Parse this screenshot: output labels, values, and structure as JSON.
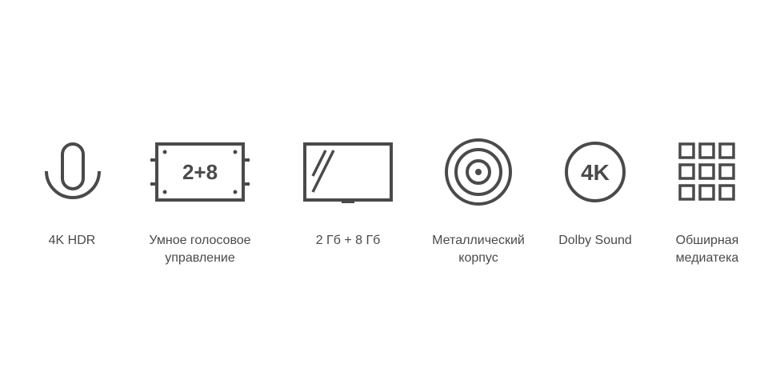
{
  "colors": {
    "icon_stroke": "#4a4a4a",
    "text": "#4a4a4a",
    "background": "#ffffff"
  },
  "features": [
    {
      "icon": "microphone-icon",
      "label_lines": [
        "4K HDR"
      ]
    },
    {
      "icon": "chip-icon",
      "icon_text": "2+8",
      "label_lines": [
        "Умное голосовое",
        "управление"
      ]
    },
    {
      "icon": "tv-screen-icon",
      "label_lines": [
        "2 Гб + 8 Гб"
      ]
    },
    {
      "icon": "target-icon",
      "label_lines": [
        "Металлический",
        "корпус"
      ]
    },
    {
      "icon": "4k-badge-icon",
      "icon_text": "4K",
      "label_lines": [
        "Dolby Sound"
      ]
    },
    {
      "icon": "grid-icon",
      "label_lines": [
        "Обширная",
        "медиатека"
      ]
    }
  ]
}
